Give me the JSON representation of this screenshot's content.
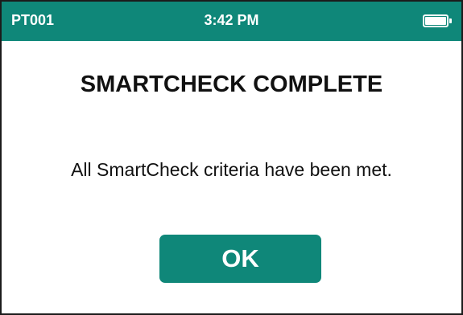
{
  "status_bar": {
    "device_id": "PT001",
    "time": "3:42 PM",
    "battery_icon": "battery-full-icon",
    "background_color": "#0f8779"
  },
  "dialog": {
    "title": "SMARTCHECK COMPLETE",
    "message": "All SmartCheck criteria have been met.",
    "ok_button": "OK",
    "accent_color": "#0f8779"
  }
}
